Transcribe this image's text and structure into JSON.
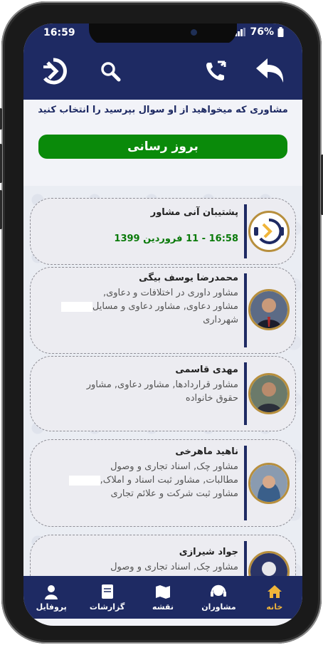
{
  "status": {
    "time": "16:59",
    "battery": "76%"
  },
  "header": {
    "subtitle": "مشاوری که میخواهید از او سوال بپرسید را انتخاب کنید",
    "refresh_label": "بروز رسانی"
  },
  "cards": [
    {
      "name": "پشتیبان آنی مشاور",
      "date": "16:58 - 11 فروردین 1399"
    },
    {
      "name": "محمدرضا یوسف بیگی",
      "line1": "مشاور  داوری در اختلافات و دعاوی,",
      "line2": "مشاور دعاوی, مشاور دعاوی و مسایل",
      "line3": "شهرداری"
    },
    {
      "name": "مهدی قاسمی",
      "line1": "مشاور قراردادها, مشاور دعاوی, مشاور",
      "line2": "حقوق خانواده"
    },
    {
      "name": "ناهید ماهرخی",
      "line1": "مشاور چک, اسناد تجاری و وصول",
      "line2": "مطالبات, مشاور ثبت اسناد و املاک,",
      "line3": "مشاور ثبت شرکت و علائم تجاری"
    },
    {
      "name": "جواد  شیرازی",
      "line1": "مشاور چک, اسناد تجاری و وصول"
    }
  ],
  "nav": {
    "profile": "پروفایل",
    "reports": "گزارشات",
    "map": "نقشه",
    "advisors": "مشاوران",
    "home": "خانه"
  },
  "colors": {
    "primary": "#1e2a63",
    "accent": "#f0b53a",
    "green": "#0a8a0a"
  }
}
